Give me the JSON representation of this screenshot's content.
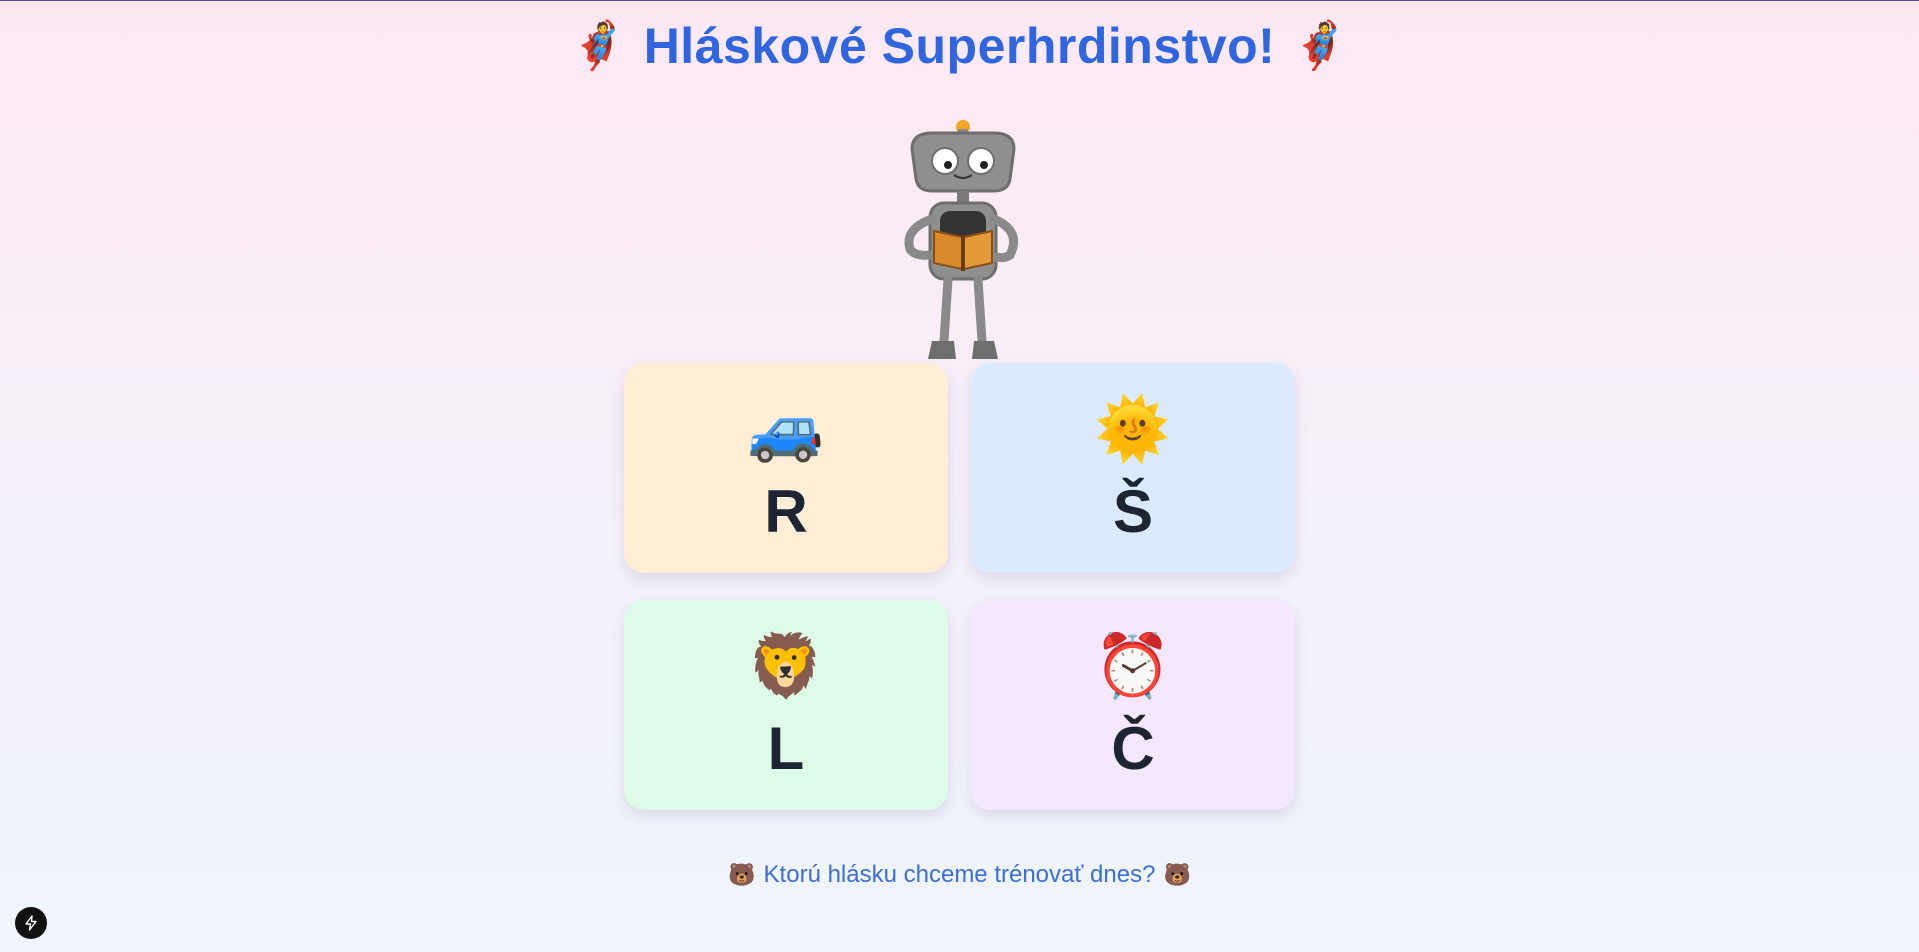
{
  "header": {
    "title": "Hláskové Superhrdinstvo!",
    "emoji_left": "🦸",
    "emoji_right": "🦸"
  },
  "mascot": {
    "icon": "robot-reading-book"
  },
  "cards": [
    {
      "emoji": "🚙",
      "letter": "R",
      "icon": "car-icon",
      "color": "#ffedd5"
    },
    {
      "emoji": "🌞",
      "letter": "Š",
      "icon": "sun-icon",
      "color": "#dbeafe"
    },
    {
      "emoji": "🦁",
      "letter": "L",
      "icon": "lion-icon",
      "color": "#dcfce7"
    },
    {
      "emoji": "⏰",
      "letter": "Č",
      "icon": "alarm-clock-icon",
      "color": "#f3e8ff"
    }
  ],
  "prompt": {
    "text": "Ktorú hlásku chceme trénovať dnes?",
    "emoji_left": "🐻",
    "emoji_right": "🐻"
  },
  "colors": {
    "title": "#2f66e0",
    "prompt": "#3b6fd4",
    "letter": "#1d2433"
  }
}
